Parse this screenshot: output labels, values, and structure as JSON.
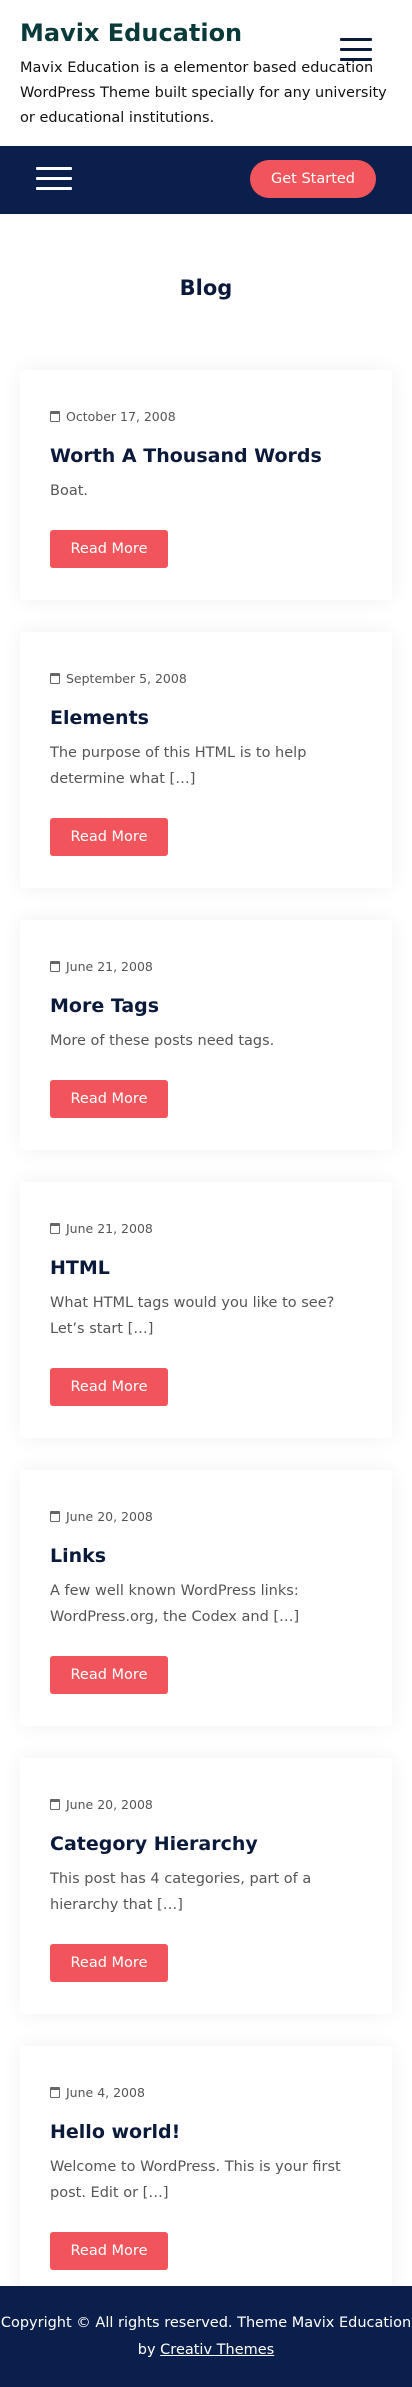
{
  "header": {
    "site_title": "Mavix Education",
    "site_description": "Mavix Education is a elementor based education WordPress Theme built specially for any university or educational institutions."
  },
  "navbar": {
    "cta_label": "Get Started"
  },
  "blog": {
    "heading": "Blog",
    "posts": [
      {
        "date": "October 17, 2008",
        "title": "Worth A Thousand Words",
        "excerpt": "Boat.",
        "read_more": "Read More"
      },
      {
        "date": "September 5, 2008",
        "title": "Elements",
        "excerpt": "The purpose of this HTML is to help determine what […]",
        "read_more": "Read More"
      },
      {
        "date": "June 21, 2008",
        "title": "More Tags",
        "excerpt": "More of these posts need tags.",
        "read_more": "Read More"
      },
      {
        "date": "June 21, 2008",
        "title": "HTML",
        "excerpt": "What HTML tags would you like to see? Let’s start […]",
        "read_more": "Read More"
      },
      {
        "date": "June 20, 2008",
        "title": "Links",
        "excerpt": "A few well known WordPress links: WordPress.org, the Codex and […]",
        "read_more": "Read More"
      },
      {
        "date": "June 20, 2008",
        "title": "Category Hierarchy",
        "excerpt": "This post has 4 categories, part of a hierarchy that […]",
        "read_more": "Read More"
      },
      {
        "date": "June 4, 2008",
        "title": "Hello world!",
        "excerpt": "Welcome to WordPress. This is your first post. Edit or […]",
        "read_more": "Read More"
      }
    ]
  },
  "footer": {
    "copyright": "Copyright © All rights reserved. Theme Mavix Education by",
    "author_link": "Creativ Themes"
  },
  "colors": {
    "navy": "#0b1f4d",
    "accent": "#f2545b"
  }
}
